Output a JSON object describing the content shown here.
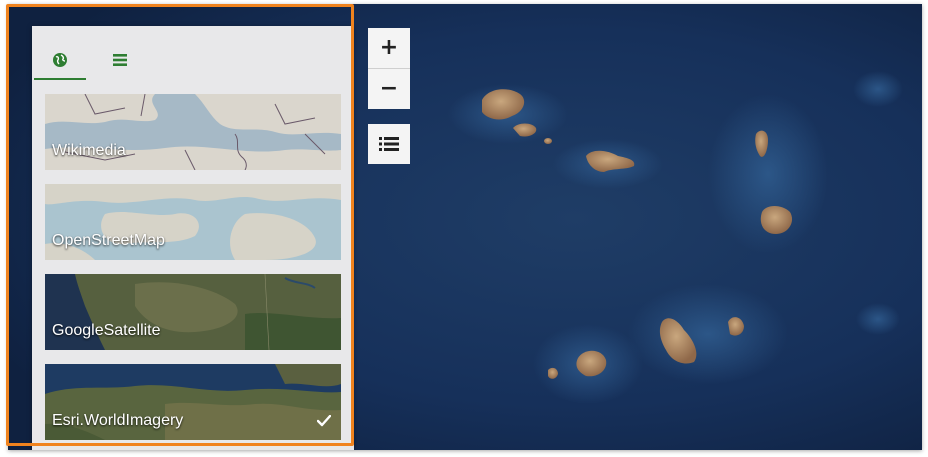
{
  "map": {
    "ocean_color": "#13294a",
    "land_color": "#a98160",
    "basemap_selected": "Esri.WorldImagery"
  },
  "panel": {
    "tabs": [
      {
        "icon": "globe-icon",
        "active": true,
        "accent": "#2e7d32"
      },
      {
        "icon": "list-icon",
        "active": false,
        "accent": "#2e7d32"
      }
    ],
    "basemaps": [
      {
        "label": "Wikimedia",
        "selected": false
      },
      {
        "label": "OpenStreetMap",
        "selected": false
      },
      {
        "label": "GoogleSatellite",
        "selected": false
      },
      {
        "label": "Esri.WorldImagery",
        "selected": true
      }
    ]
  },
  "controls": {
    "zoom_in": "+",
    "zoom_out": "−",
    "layers_icon": "layers-list-icon"
  },
  "highlight_color": "#f0831e"
}
